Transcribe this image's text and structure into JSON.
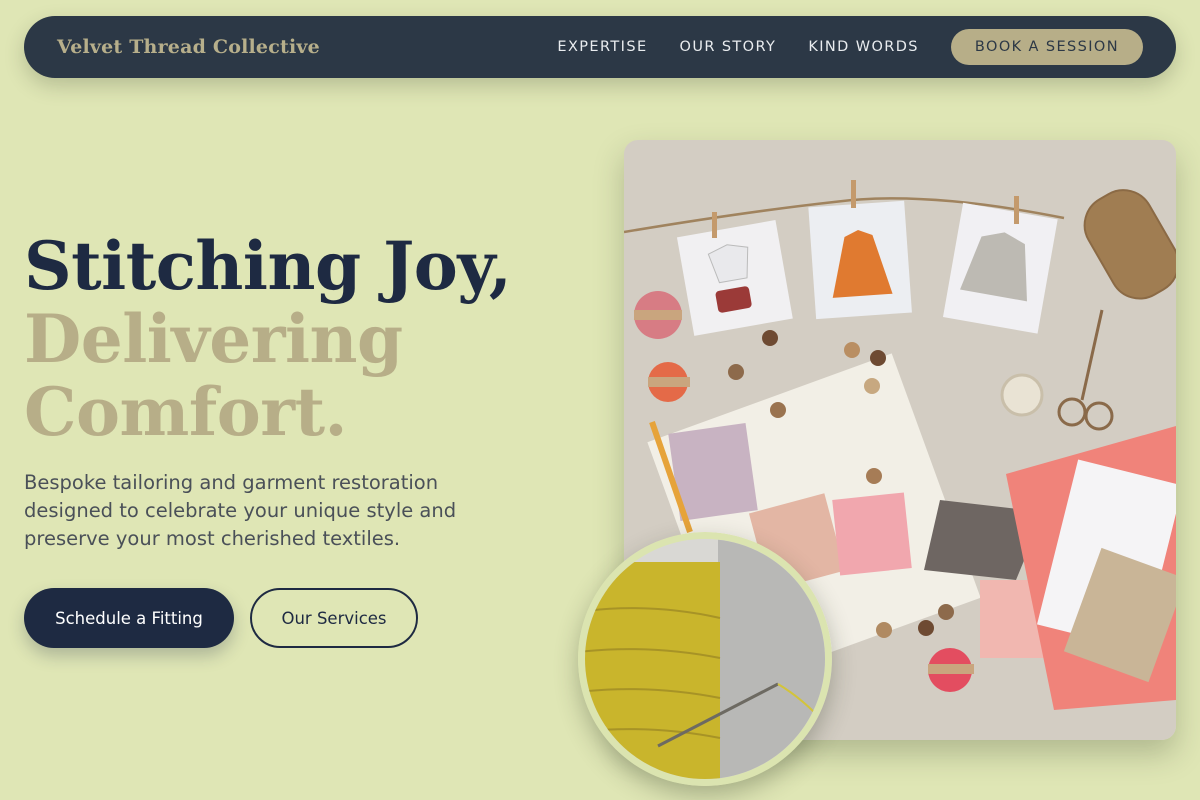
{
  "nav": {
    "brand": "Velvet Thread Collective",
    "links": [
      "EXPERTISE",
      "OUR STORY",
      "KIND WORDS"
    ],
    "cta": "BOOK A SESSION"
  },
  "hero": {
    "headline_line1": "Stitching Joy,",
    "headline_line2": "Delivering",
    "headline_line3": "Comfort.",
    "subtext": "Bespoke tailoring and garment restoration designed to celebrate your unique style and preserve your most cherished textiles.",
    "primary_button": "Schedule a Fitting",
    "secondary_button": "Our Services"
  },
  "images": {
    "main_photo": "Flat lay of sewing supplies: garment sketches on a twine line, thread spools, buttons, fabric swatches, scissors and pink fabric",
    "inset_photo": "Close-up of a yellow thread spool with a needle"
  },
  "colors": {
    "page_bg": "#dfe6b5",
    "navy": "#1e2a42",
    "nav_bg": "#2c3846",
    "accent_tan": "#b7ae88"
  }
}
